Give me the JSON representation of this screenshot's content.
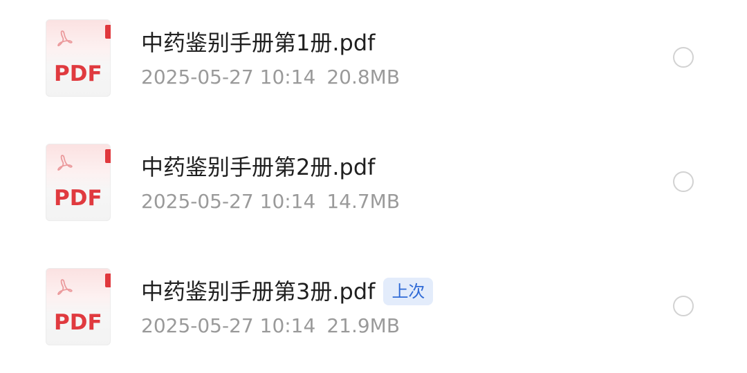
{
  "files": [
    {
      "icon_label": "PDF",
      "name": "中药鉴别手册第1册.pdf",
      "date": "2025-05-27 10:14",
      "size": "20.8MB",
      "badge": ""
    },
    {
      "icon_label": "PDF",
      "name": "中药鉴别手册第2册.pdf",
      "date": "2025-05-27 10:14",
      "size": "14.7MB",
      "badge": ""
    },
    {
      "icon_label": "PDF",
      "name": "中药鉴别手册第3册.pdf",
      "date": "2025-05-27 10:14",
      "size": "21.9MB",
      "badge": "上次"
    }
  ],
  "colors": {
    "pdf_red": "#e03a3f",
    "badge_bg": "#e3ecfb",
    "badge_text": "#2f6ad6",
    "meta_text": "#9a9a9a",
    "title_text": "#1f1f1f"
  },
  "icons": {
    "file_type": "pdf-file-icon",
    "select": "radio-unchecked-icon"
  }
}
